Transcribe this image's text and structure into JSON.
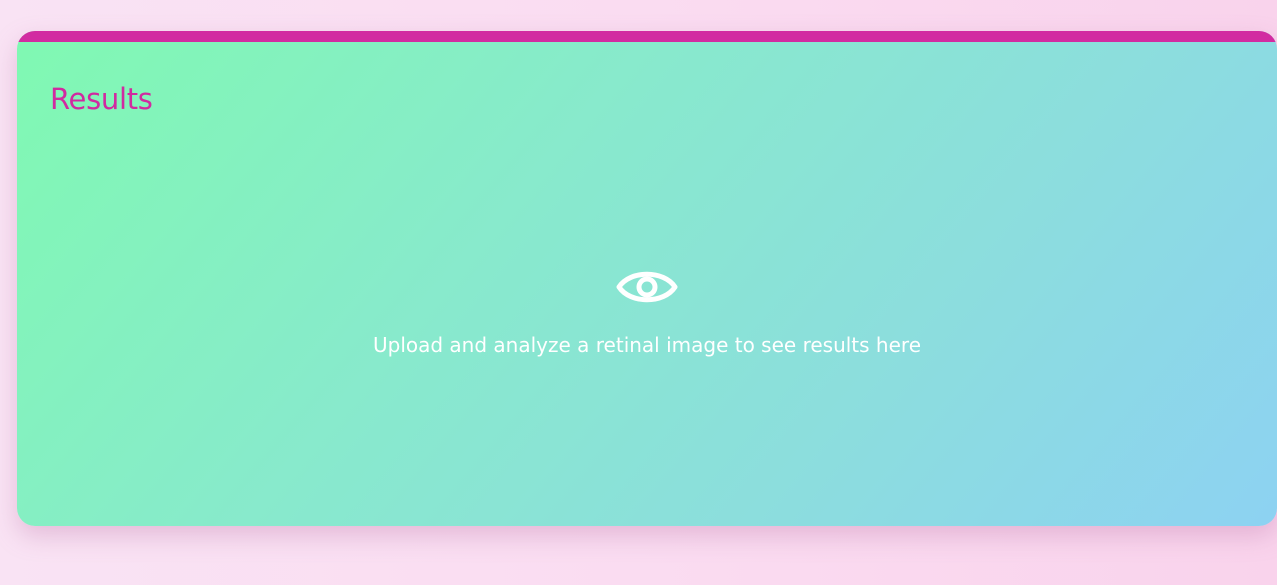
{
  "results": {
    "title": "Results",
    "empty_state": {
      "icon": "eye-icon",
      "message": "Upload and analyze a retinal image to see results here"
    }
  },
  "colors": {
    "accent": "#d22ba1",
    "gradient_start": "#80f9b2",
    "gradient_end": "#8dd2f2",
    "empty_text": "#ffffff"
  }
}
